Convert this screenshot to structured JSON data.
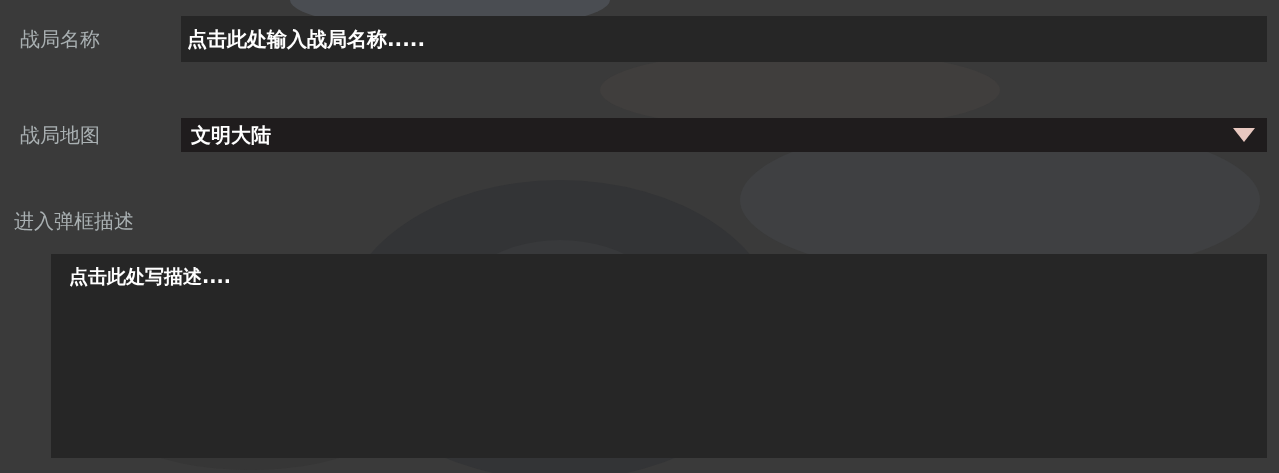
{
  "name_field": {
    "label": "战局名称",
    "placeholder": "点击此处输入战局名称....."
  },
  "map_select": {
    "label": "战局地图",
    "value": "文明大陆"
  },
  "description": {
    "label": "进入弹框描述",
    "placeholder": "点击此处写描述...."
  }
}
